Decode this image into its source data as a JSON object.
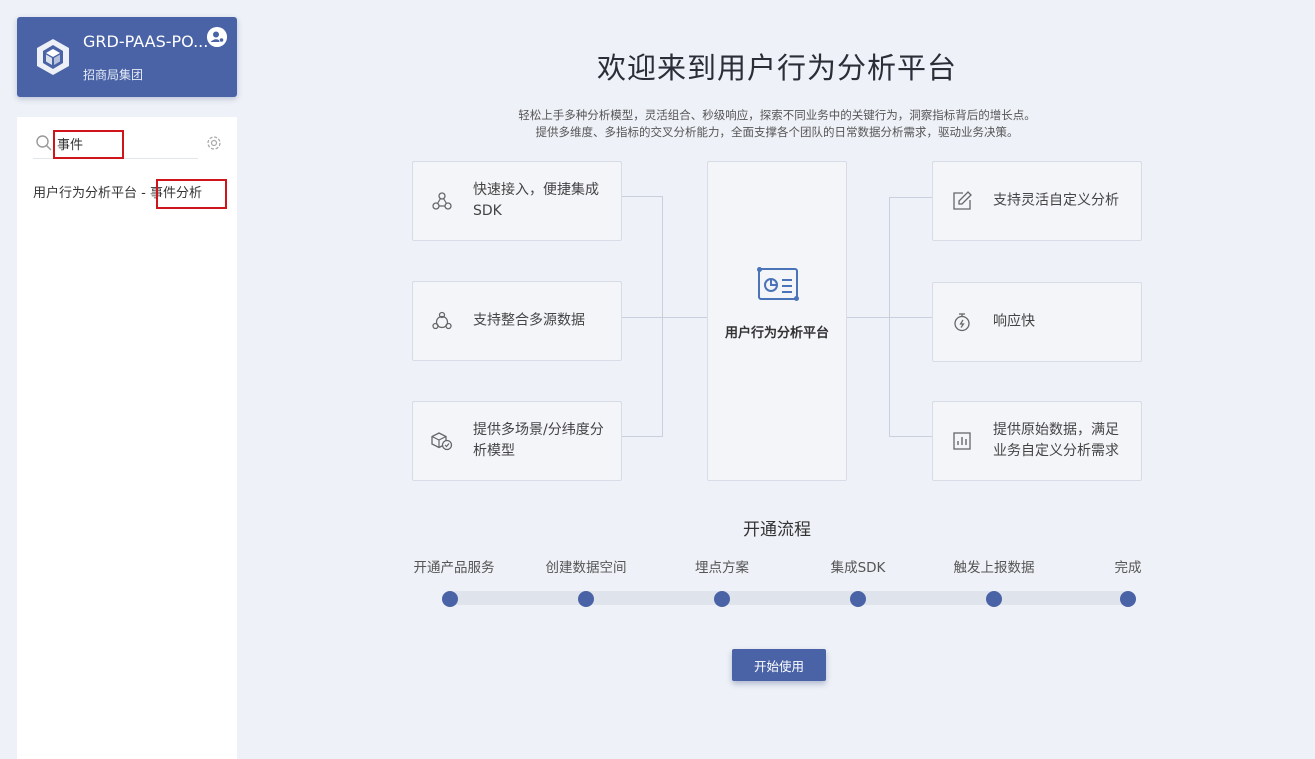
{
  "project": {
    "name": "GRD-PAAS-PO...",
    "org": "招商局集团"
  },
  "search": {
    "value": "事件"
  },
  "results": [
    {
      "prefix": "用户行为分析平台 - ",
      "match": "事件分析"
    }
  ],
  "main": {
    "title": "欢迎来到用户行为分析平台",
    "desc_line1": "轻松上手多种分析模型，灵活组合、秒级响应，探索不同业务中的关键行为，洞察指标背后的增长点。",
    "desc_line2": "提供多维度、多指标的交叉分析能力，全面支撑各个团队的日常数据分析需求，驱动业务决策。",
    "center_label": "用户行为分析平台",
    "left_features": [
      {
        "text": "快速接入，便捷集成SDK",
        "icon": "sdk-icon"
      },
      {
        "text": "支持整合多源数据",
        "icon": "multi-source-icon"
      },
      {
        "text": "提供多场景/分纬度分析模型",
        "icon": "model-icon"
      }
    ],
    "right_features": [
      {
        "text": "支持灵活自定义分析",
        "icon": "edit-icon"
      },
      {
        "text": "响应快",
        "icon": "stopwatch-icon"
      },
      {
        "text": "提供原始数据，满足业务自定义分析需求",
        "icon": "bar-chart-icon"
      }
    ]
  },
  "flow": {
    "title": "开通流程",
    "steps": [
      "开通产品服务",
      "创建数据空间",
      "埋点方案",
      "集成SDK",
      "触发上报数据",
      "完成"
    ]
  },
  "actions": {
    "start_label": "开始使用"
  },
  "colors": {
    "primary": "#4a63a6",
    "highlight_box": "#d0141b",
    "background": "#eef1f7"
  }
}
